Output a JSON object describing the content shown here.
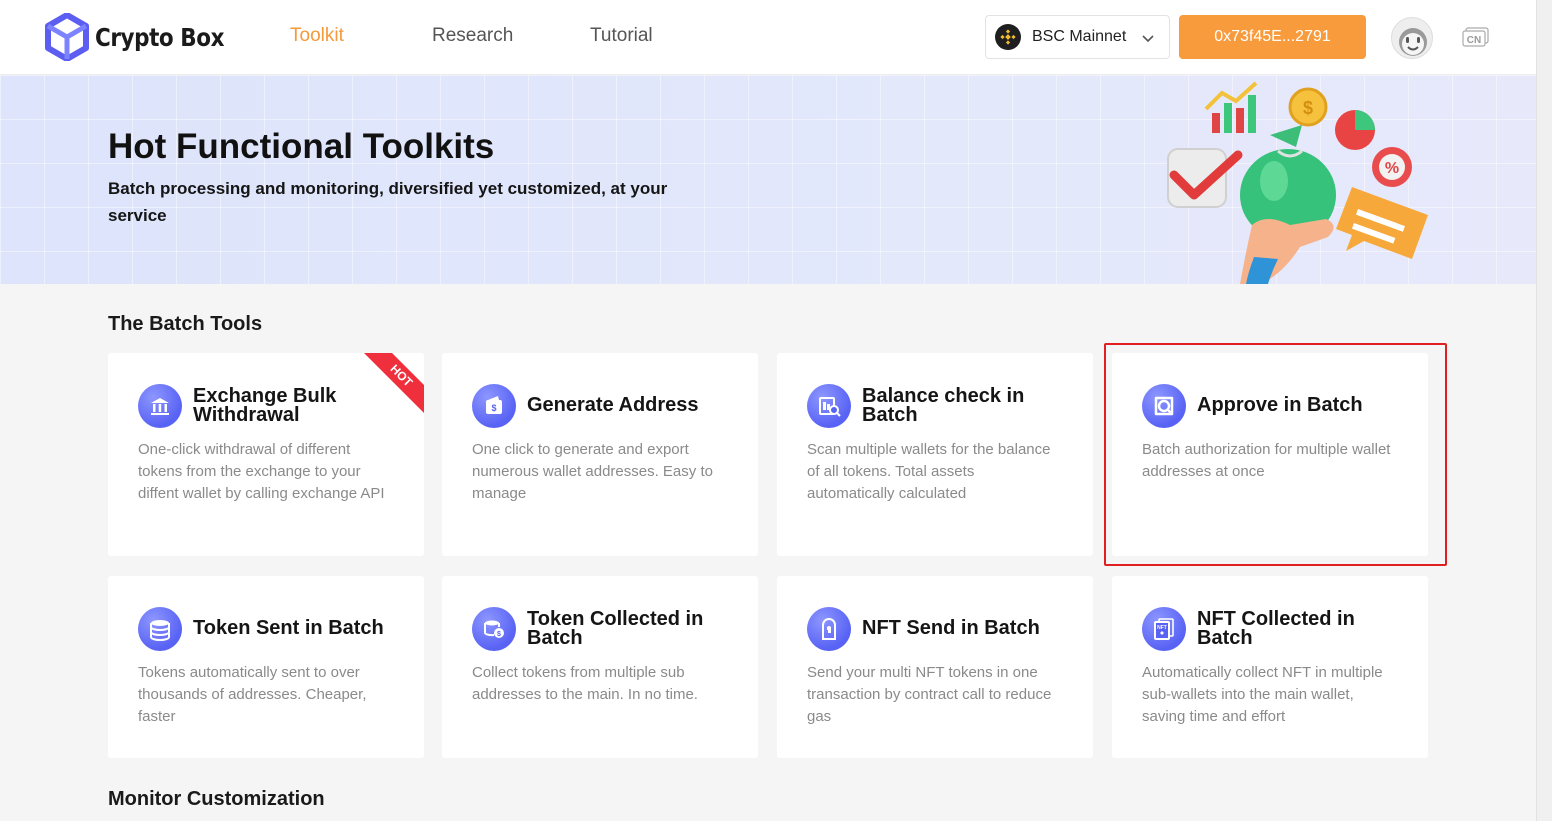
{
  "header": {
    "logo_text": "Crypto Box",
    "nav": [
      {
        "label": "Toolkit",
        "active": true
      },
      {
        "label": "Research",
        "active": false
      },
      {
        "label": "Tutorial",
        "active": false
      }
    ],
    "network": {
      "label": "BSC Mainnet",
      "icon": "bnb-chain-icon"
    },
    "wallet_address": "0x73f45E...2791",
    "language_icon": "CN",
    "colors": {
      "accent": "#f79b3d",
      "active_nav": "#f49a3a",
      "brand": "#5b5ef0"
    }
  },
  "banner": {
    "title": "Hot Functional Toolkits",
    "subtitle": "Batch processing and monitoring, diversified yet customized, at your service"
  },
  "batch_tools": {
    "title": "The Batch Tools",
    "cards": [
      {
        "title": "Exchange Bulk Withdrawal",
        "description": "One-click withdrawal of different tokens from the exchange to your diffent wallet by calling exchange API",
        "icon": "bank-withdraw-icon",
        "badge": "HOT"
      },
      {
        "title": "Generate Address",
        "description": "One click to generate and export numerous wallet addresses. Easy to manage",
        "icon": "wallet-icon"
      },
      {
        "title": "Balance check in Batch",
        "description": "Scan multiple wallets for the balance of all tokens. Total assets automatically calculated",
        "icon": "balance-scan-icon"
      },
      {
        "title": "Approve in Batch",
        "description": "Batch authorization for multiple wallet addresses at once",
        "icon": "approve-icon",
        "highlighted": true
      },
      {
        "title": "Token Sent in Batch",
        "description": "Tokens automatically sent to over thousands of addresses. Cheaper, faster",
        "icon": "coins-stack-icon"
      },
      {
        "title": "Token Collected in Batch",
        "description": "Collect tokens from multiple sub addresses to the main. In no time.",
        "icon": "token-collect-icon"
      },
      {
        "title": "NFT Send in Batch",
        "description": "Send your multi NFT tokens in one transaction by contract call to reduce gas",
        "icon": "nft-send-icon"
      },
      {
        "title": "NFT Collected in Batch",
        "description": "Automatically collect NFT in multiple sub-wallets into the main wallet, saving time and effort",
        "icon": "nft-collect-icon"
      }
    ]
  },
  "monitor": {
    "title": "Monitor Customization"
  }
}
